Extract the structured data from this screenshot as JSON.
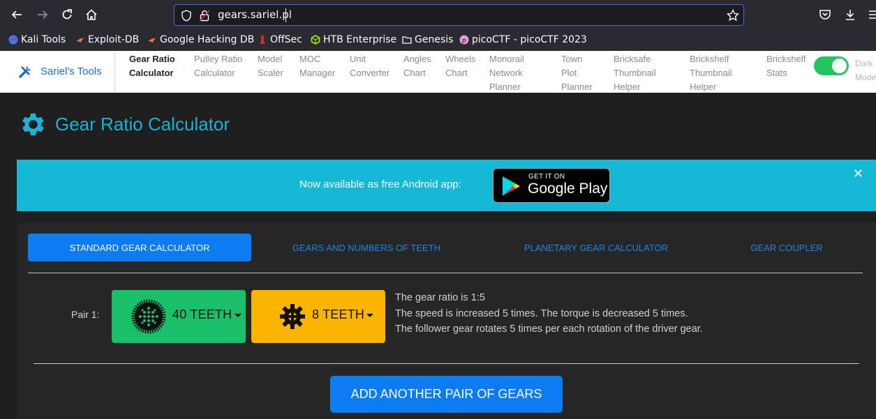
{
  "browser": {
    "url": "gears.sariel.pl",
    "bookmarks": [
      {
        "label": "Kali Tools",
        "icon": "kali-icon"
      },
      {
        "label": "Exploit-DB",
        "icon": "exploitdb-icon"
      },
      {
        "label": "Google Hacking DB",
        "icon": "exploitdb-icon"
      },
      {
        "label": "OffSec",
        "icon": "offsec-icon"
      },
      {
        "label": "HTB Enterprise",
        "icon": "htb-icon"
      },
      {
        "label": "Genesis",
        "icon": "folder-icon"
      },
      {
        "label": "picoCTF - picoCTF 2023",
        "icon": "picoctf-icon"
      }
    ]
  },
  "site_nav": {
    "brand": "Sariel's Tools",
    "items": [
      {
        "label": "Gear Ratio\nCalculator",
        "active": true
      },
      {
        "label": "Pulley Ratio\nCalculator"
      },
      {
        "label": "Model\nScaler"
      },
      {
        "label": "MOC\nManager"
      },
      {
        "label": "Unit\nConverter"
      },
      {
        "label": "Angles\nChart"
      },
      {
        "label": "Wheels\nChart"
      },
      {
        "label": "Monorail\nNetwork\nPlanner"
      },
      {
        "label": "Town\nPlot\nPlanner"
      },
      {
        "label": "Bricksafe\nThumbnail\nHelper"
      },
      {
        "label": "Brickshelf\nThumbnail\nHelper"
      },
      {
        "label": "Brickshelf\nStats"
      }
    ],
    "dark_mode_label": "Dark\nMode",
    "dark_mode_on": true
  },
  "page": {
    "title": "Gear Ratio Calculator"
  },
  "banner": {
    "text": "Now available as free Android app:",
    "badge_small": "GET IT ON",
    "badge_big": "Google Play",
    "close": "✕"
  },
  "calculator": {
    "tabs": [
      {
        "label": "STANDARD GEAR CALCULATOR",
        "active": true
      },
      {
        "label": "GEARS AND NUMBERS OF TEETH"
      },
      {
        "label": "PLANETARY GEAR CALCULATOR"
      },
      {
        "label": "GEAR COUPLER"
      }
    ],
    "pair_label": "Pair 1:",
    "driver_gear": "40 TEETH",
    "follower_gear": "8 TEETH",
    "results": {
      "ratio": "The gear ratio is 1:5",
      "speed": "The speed is increased 5 times. The torque is decreased 5 times.",
      "rotation": "The follower gear rotates 5 times per each rotation of the driver gear."
    },
    "add_button": "ADD ANOTHER PAIR OF GEARS"
  },
  "colors": {
    "accent_blue": "#0d7cf2",
    "title_cyan": "#1ab2d6",
    "banner_cyan": "#16b8d8",
    "gear_green": "#19c069",
    "gear_yellow": "#fbb500"
  }
}
